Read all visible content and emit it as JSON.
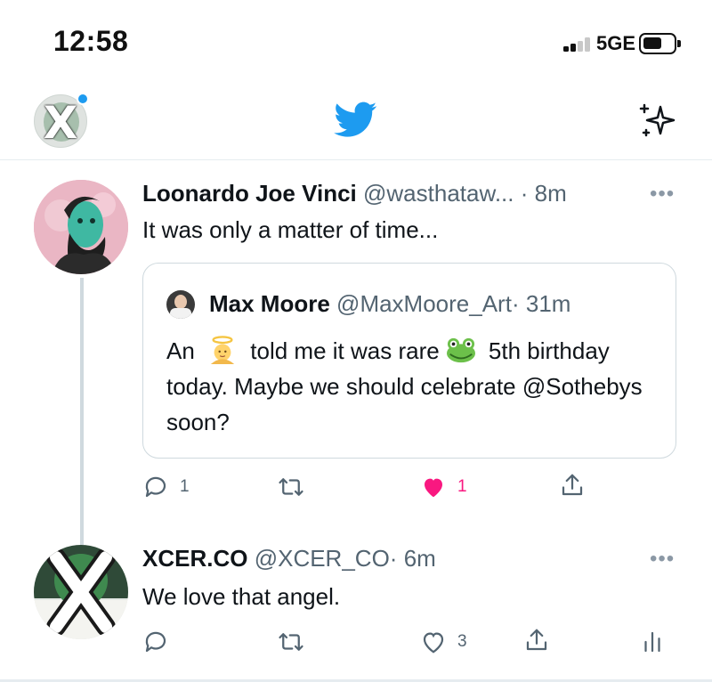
{
  "status_bar": {
    "time": "12:58",
    "network": "5GE"
  },
  "header": {
    "logo_icon": "twitter-bird-icon",
    "sparkle_icon": "sparkle-icon",
    "accent_color": "#1d9bf0"
  },
  "tweet1": {
    "name": "Loonardo Joe Vinci",
    "handle": "@wasthataw...",
    "separator": "·",
    "age": "8m",
    "more": "•••",
    "text": "It was only a matter of time...",
    "quote": {
      "name": "Max Moore",
      "handle": "@MaxMoore_Art",
      "separator": "·",
      "age": "31m",
      "text_part1": "An",
      "text_part2": "told me it was rare",
      "text_part3": "5th birthday today. Maybe we should celebrate @Sothebys soon?",
      "emoji1": "angel-emoji",
      "emoji2": "frog-emoji"
    },
    "actions": {
      "reply_count": "1",
      "retweet_count": "",
      "like_count": "1",
      "like_color": "#f91880"
    }
  },
  "tweet2": {
    "name": "XCER.CO",
    "handle": "@XCER_CO",
    "separator": "·",
    "age": "6m",
    "more": "•••",
    "text": "We love that angel.",
    "actions": {
      "reply_count": "",
      "retweet_count": "",
      "like_count": "3"
    }
  }
}
